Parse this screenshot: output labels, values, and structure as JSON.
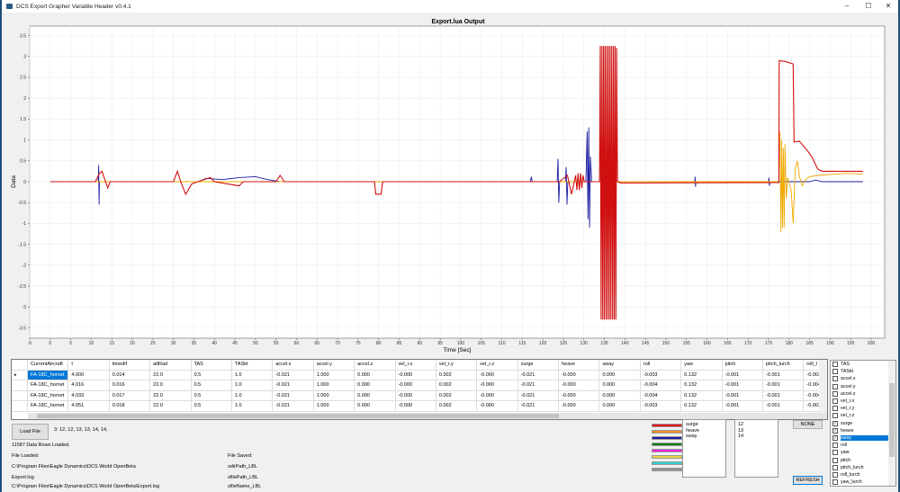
{
  "window": {
    "title": "DCS Export Grapher Variable Header v0.4.1",
    "minimize": "–",
    "maximize": "☐",
    "close": "✕"
  },
  "chart_data": {
    "type": "line",
    "title": "Export.lua Output",
    "xlabel": "Time [Sec]",
    "ylabel": "Data",
    "xlim": [
      -5,
      200
    ],
    "ylim": [
      -3.5,
      3.5
    ],
    "grid": true,
    "xticks": [
      -5,
      0,
      5,
      10,
      15,
      20,
      25,
      30,
      35,
      40,
      45,
      50,
      55,
      60,
      65,
      70,
      75,
      80,
      85,
      90,
      95,
      100,
      105,
      110,
      115,
      120,
      125,
      130,
      135,
      140,
      145,
      150,
      155,
      160,
      165,
      170,
      175,
      180,
      185,
      190,
      195,
      200
    ],
    "yticks": [
      3.5,
      3,
      2.5,
      2,
      1.5,
      1,
      0.5,
      0,
      -0.5,
      -1,
      -1.5,
      -2,
      -2.5,
      -3,
      -3.5
    ],
    "series": [
      {
        "name": "sway",
        "color": "#1a1aa0",
        "points": [
          [
            0,
            0
          ],
          [
            11.7,
            0
          ],
          [
            11.8,
            0.4
          ],
          [
            11.9,
            -0.55
          ],
          [
            12,
            0
          ],
          [
            36,
            0
          ],
          [
            38,
            0.08
          ],
          [
            42,
            0.05
          ],
          [
            46,
            0.1
          ],
          [
            50,
            0.12
          ],
          [
            53,
            0.05
          ],
          [
            56,
            0
          ],
          [
            117,
            0
          ],
          [
            117.2,
            0.12
          ],
          [
            117.4,
            0
          ],
          [
            123.5,
            0
          ],
          [
            123.7,
            0.55
          ],
          [
            123.9,
            -0.5
          ],
          [
            124.1,
            0
          ],
          [
            125.5,
            0
          ],
          [
            125.7,
            0.35
          ],
          [
            125.9,
            -0.55
          ],
          [
            126.1,
            0
          ],
          [
            130.5,
            0
          ],
          [
            130.8,
            1.2
          ],
          [
            131,
            -0.9
          ],
          [
            131.2,
            1.3
          ],
          [
            131.4,
            -1.1
          ],
          [
            131.6,
            0.6
          ],
          [
            131.9,
            0
          ],
          [
            157,
            0
          ],
          [
            157.1,
            0.12
          ],
          [
            157.2,
            -0.12
          ],
          [
            157.3,
            0
          ],
          [
            175,
            0
          ],
          [
            175.1,
            0.1
          ],
          [
            175.2,
            -0.1
          ],
          [
            175.3,
            0
          ],
          [
            185,
            0
          ],
          [
            186.5,
            0.04
          ],
          [
            188,
            0
          ],
          [
            198,
            0
          ]
        ]
      },
      {
        "name": "heave",
        "color": "#f0a800",
        "points": [
          [
            0,
            0
          ],
          [
            177.5,
            0
          ],
          [
            177.8,
            1.2
          ],
          [
            178,
            -1.2
          ],
          [
            178.2,
            1.0
          ],
          [
            178.4,
            -1.1
          ],
          [
            178.6,
            0.8
          ],
          [
            178.8,
            -1.1
          ],
          [
            179,
            0.9
          ],
          [
            179.3,
            -0.4
          ],
          [
            179.6,
            0.1
          ],
          [
            180.5,
            -0.2
          ],
          [
            181,
            -1.0
          ],
          [
            181.5,
            0.3
          ],
          [
            182,
            0.5
          ],
          [
            182.6,
            0.1
          ],
          [
            183.2,
            -0.1
          ],
          [
            184,
            0.05
          ],
          [
            185,
            0.12
          ],
          [
            187,
            0.15
          ],
          [
            190,
            0.17
          ],
          [
            194,
            0.2
          ],
          [
            198,
            0.18
          ]
        ]
      },
      {
        "name": "surge",
        "color": "#d01010",
        "points": [
          [
            0,
            0
          ],
          [
            11,
            0
          ],
          [
            12,
            0.2
          ],
          [
            12.6,
            0.25
          ],
          [
            13.3,
            0.05
          ],
          [
            14,
            -0.15
          ],
          [
            14.6,
            0
          ],
          [
            30,
            0
          ],
          [
            31,
            0.25
          ],
          [
            31.8,
            0
          ],
          [
            33,
            -0.3
          ],
          [
            34.5,
            -0.05
          ],
          [
            36,
            0
          ],
          [
            39,
            0.1
          ],
          [
            40,
            0
          ],
          [
            46,
            -0.1
          ],
          [
            47,
            0
          ],
          [
            55,
            0
          ],
          [
            56,
            0.15
          ],
          [
            57,
            0
          ],
          [
            79,
            0
          ],
          [
            79.3,
            -0.3
          ],
          [
            80.6,
            -0.3
          ],
          [
            81,
            0
          ],
          [
            124,
            0
          ],
          [
            126,
            0.15
          ],
          [
            127,
            -0.3
          ],
          [
            128,
            0.15
          ],
          [
            128.3,
            -0.2
          ],
          [
            128.6,
            0.2
          ],
          [
            128.9,
            -0.2
          ],
          [
            129.2,
            0.2
          ],
          [
            129.5,
            -0.15
          ],
          [
            129.8,
            0.15
          ],
          [
            130.1,
            0
          ],
          [
            133.8,
            0
          ],
          [
            134,
            3.25
          ],
          [
            134.2,
            -3.3
          ],
          [
            134.4,
            3.25
          ],
          [
            134.6,
            -3.3
          ],
          [
            134.8,
            3.25
          ],
          [
            135,
            -3.3
          ],
          [
            135.2,
            3.25
          ],
          [
            135.4,
            -3.3
          ],
          [
            135.6,
            3.25
          ],
          [
            135.8,
            -3.3
          ],
          [
            136,
            3.25
          ],
          [
            136.2,
            -3.3
          ],
          [
            136.4,
            3.25
          ],
          [
            136.6,
            -3.3
          ],
          [
            136.8,
            3.25
          ],
          [
            137,
            -3.3
          ],
          [
            137.2,
            3.25
          ],
          [
            137.4,
            -3.3
          ],
          [
            137.6,
            3.25
          ],
          [
            137.8,
            -3.3
          ],
          [
            138,
            3.2
          ],
          [
            138.2,
            0
          ],
          [
            139,
            -0.03
          ],
          [
            177.5,
            -0.02
          ],
          [
            177.6,
            2.9
          ],
          [
            179,
            2.88
          ],
          [
            181,
            2.82
          ],
          [
            181.2,
            0.95
          ],
          [
            182.5,
            0.97
          ],
          [
            184,
            0.8
          ],
          [
            185.5,
            0.6
          ],
          [
            187,
            0.3
          ],
          [
            188,
            0.25
          ],
          [
            192,
            0.25
          ],
          [
            198,
            0.25
          ]
        ]
      }
    ]
  },
  "table": {
    "columns": [
      "CurrentAircraft",
      "t",
      "timedif",
      "altRad",
      "TAS",
      "TASkt",
      "accel.x",
      "accel.y",
      "accel.z",
      "vel_r.x",
      "vel_r.y",
      "vel_r.z",
      "surge",
      "heave",
      "sway",
      "roll",
      "yaw",
      "pitch",
      "pitch_lurch",
      "roll_l"
    ],
    "rows": [
      [
        "FA-18C_hornet",
        "4.000",
        "0.014",
        "22.0",
        "0.5",
        "1.0",
        "-0.021",
        "1.000",
        "0.000",
        "-0.000",
        "0.002",
        "-0.000",
        "-0.021",
        "-0.000",
        "0.000",
        "-0.003",
        "0.132",
        "-0.001",
        "-0.001",
        "-0.003"
      ],
      [
        "FA-18C_hornet",
        "4.016",
        "0.016",
        "22.0",
        "0.5",
        "1.0",
        "-0.021",
        "1.000",
        "0.000",
        "-0.000",
        "0.002",
        "-0.000",
        "-0.021",
        "-0.000",
        "0.000",
        "-0.004",
        "0.132",
        "-0.001",
        "-0.001",
        "-0.004"
      ],
      [
        "FA-18C_hornet",
        "4.033",
        "0.017",
        "22.0",
        "0.5",
        "1.0",
        "-0.021",
        "1.000",
        "0.000",
        "-0.000",
        "0.002",
        "-0.000",
        "-0.021",
        "-0.000",
        "0.000",
        "-0.004",
        "0.132",
        "-0.001",
        "-0.001",
        "-0.004"
      ],
      [
        "FA-18C_hornet",
        "4.051",
        "0.018",
        "22.0",
        "0.5",
        "1.0",
        "-0.021",
        "1.000",
        "0.000",
        "-0.000",
        "0.002",
        "-0.000",
        "-0.021",
        "-0.000",
        "0.000",
        "-0.003",
        "0.132",
        "-0.001",
        "-0.001",
        "-0.003"
      ]
    ],
    "current_row_marker": "▸"
  },
  "controls": {
    "load_file": "Load File",
    "indices_text": "3: 12, 12, 13, 13, 14, 14,",
    "rows_loaded": "11587 Data Rows Loaded.",
    "file_loaded_label": "File Loaded:",
    "dir_path": "C:\\Program Files\\Eagle Dynamics\\DCS World OpenBeta",
    "file_name": "Export.log",
    "full_path": "C:\\Program Files\\Eagle Dynamics\\DCS World OpenBeta\\Export.log",
    "file_saved_label": "File Saved:",
    "sdir": "sdirPath_LBL",
    "sfile": "sfilePath_LBL",
    "sname": "sfileName_LBL",
    "none": "NONE",
    "refresh": "REFRESH"
  },
  "legend_colors": [
    "#e01010",
    "#f09030",
    "#1a1aa0",
    "#108010",
    "#f020e0",
    "#f0d040",
    "#30d0d0",
    "#909090"
  ],
  "selected_names": [
    "surge",
    "heave",
    "sway"
  ],
  "selected_indices": [
    "12",
    "13",
    "14"
  ],
  "variables": [
    {
      "name": "TAS",
      "checked": false
    },
    {
      "name": "TASkt",
      "checked": false
    },
    {
      "name": "accel.x",
      "checked": false
    },
    {
      "name": "accel.y",
      "checked": false
    },
    {
      "name": "accel.z",
      "checked": false
    },
    {
      "name": "vel_r.x",
      "checked": false
    },
    {
      "name": "vel_r.y",
      "checked": false
    },
    {
      "name": "vel_r.z",
      "checked": false
    },
    {
      "name": "surge",
      "checked": true
    },
    {
      "name": "heave",
      "checked": true
    },
    {
      "name": "sway",
      "checked": true,
      "selected": true
    },
    {
      "name": "roll",
      "checked": false
    },
    {
      "name": "yaw",
      "checked": false
    },
    {
      "name": "pitch",
      "checked": false
    },
    {
      "name": "pitch_lurch",
      "checked": false
    },
    {
      "name": "roll_lurch",
      "checked": false
    },
    {
      "name": "yaw_lurch",
      "checked": false
    }
  ]
}
